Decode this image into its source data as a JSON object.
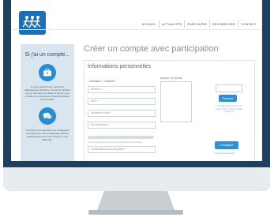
{
  "nav": {
    "items": [
      "ACCUEIL",
      "ACTUALITÉS",
      "PARCOURIR",
      "RECHERCHER",
      "CONTACT"
    ]
  },
  "sidebar": {
    "title": "Si j'ai un compte...",
    "paragraph1": "Je peux sélectionner mes fiches pédagogiques favorites, choisir les activités que je veux faire en classe et les lier pour constituer un programme transdisciplinaire personnalisé.",
    "paragraph2": "J'enrichis mon expérience en échangeant des idées avec des enseignants d'autres établissements sur mes succès et mes difficultés."
  },
  "main": {
    "title": "Créer un compte avec participation",
    "section_title": "Informations personnelles",
    "gender_label": "○ Monsieur ○ Madame",
    "fields": [
      "Prénom *",
      "Nom *",
      "Adresse e-mail *",
      "Mot de passe *",
      "Confirmation mot de passe *"
    ],
    "password_hint": "Le mot de passe doit contenir au minimum 6 caractères",
    "photo_label": "Ajouter une photo",
    "browse_label": "Parcourir",
    "browse_note": "Veuillez sélectionner une image JPG ou PNG de 70ko maximum",
    "submit_label": "Enregistrer",
    "required_note": "* Champs obligatoires"
  },
  "colors": {
    "frame": "#1f3f5f",
    "accent": "#2f8fd6",
    "sidebar_bg": "#d9e6f0"
  }
}
